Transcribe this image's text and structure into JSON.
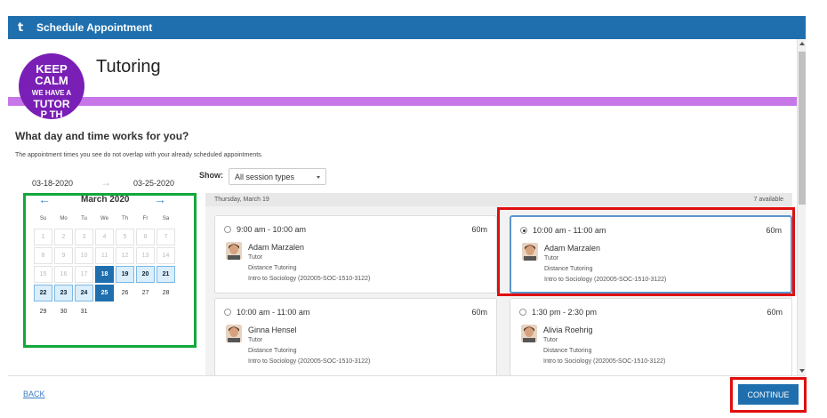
{
  "window": {
    "logo": "t",
    "title": "Schedule Appointment"
  },
  "header": {
    "title": "Tutoring",
    "badge_lines": [
      "KEEP",
      "CALM",
      "WE HAVE A",
      "TUTOR",
      "P TH"
    ]
  },
  "intro": {
    "question": "What day and time works for you?",
    "hint": "The appointment times you see do not overlap with your already scheduled appointments."
  },
  "range": {
    "start": "03-18-2020",
    "end": "03-25-2020",
    "arrow": "→"
  },
  "filter": {
    "label": "Show:",
    "value": "All session types"
  },
  "calendar": {
    "month": "March 2020",
    "prev": "←",
    "next": "→",
    "dow": [
      "Su",
      "Mo",
      "Tu",
      "We",
      "Th",
      "Fr",
      "Sa"
    ],
    "weeks": [
      [
        {
          "d": "1",
          "s": "past"
        },
        {
          "d": "2",
          "s": "past"
        },
        {
          "d": "3",
          "s": "past"
        },
        {
          "d": "4",
          "s": "past"
        },
        {
          "d": "5",
          "s": "past"
        },
        {
          "d": "6",
          "s": "past"
        },
        {
          "d": "7",
          "s": "past"
        }
      ],
      [
        {
          "d": "8",
          "s": "past"
        },
        {
          "d": "9",
          "s": "past"
        },
        {
          "d": "10",
          "s": "past"
        },
        {
          "d": "11",
          "s": "past"
        },
        {
          "d": "12",
          "s": "past"
        },
        {
          "d": "13",
          "s": "past"
        },
        {
          "d": "14",
          "s": "past"
        }
      ],
      [
        {
          "d": "15",
          "s": "past"
        },
        {
          "d": "16",
          "s": "past"
        },
        {
          "d": "17",
          "s": "past"
        },
        {
          "d": "18",
          "s": "sel"
        },
        {
          "d": "19",
          "s": "avail"
        },
        {
          "d": "20",
          "s": "avail"
        },
        {
          "d": "21",
          "s": "avail"
        }
      ],
      [
        {
          "d": "22",
          "s": "avail"
        },
        {
          "d": "23",
          "s": "avail"
        },
        {
          "d": "24",
          "s": "avail"
        },
        {
          "d": "25",
          "s": "sel"
        },
        {
          "d": "26",
          "s": "norm"
        },
        {
          "d": "27",
          "s": "norm"
        },
        {
          "d": "28",
          "s": "norm"
        }
      ],
      [
        {
          "d": "29",
          "s": "norm"
        },
        {
          "d": "30",
          "s": "norm"
        },
        {
          "d": "31",
          "s": "norm"
        },
        {
          "d": "",
          "s": "empty"
        },
        {
          "d": "",
          "s": "empty"
        },
        {
          "d": "",
          "s": "empty"
        },
        {
          "d": "",
          "s": "empty"
        }
      ]
    ]
  },
  "slots": {
    "date": "Thursday, March 19",
    "count": "7 available",
    "items": [
      {
        "time": "9:00 am - 10:00 am",
        "duration": "60m",
        "tutor": "Adam Marzalen",
        "role": "Tutor",
        "type": "Distance Tutoring",
        "course": "Intro to Sociology (202005-SOC-1510-3122)",
        "selected": false
      },
      {
        "time": "10:00 am - 11:00 am",
        "duration": "60m",
        "tutor": "Adam Marzalen",
        "role": "Tutor",
        "type": "Distance Tutoring",
        "course": "Intro to Sociology (202005-SOC-1510-3122)",
        "selected": true
      },
      {
        "time": "10:00 am - 11:00 am",
        "duration": "60m",
        "tutor": "Ginna Hensel",
        "role": "Tutor",
        "type": "Distance Tutoring",
        "course": "Intro to Sociology (202005-SOC-1510-3122)",
        "selected": false
      },
      {
        "time": "1:30 pm - 2:30 pm",
        "duration": "60m",
        "tutor": "Alivia Roehrig",
        "role": "Tutor",
        "type": "Distance Tutoring",
        "course": "Intro to Sociology (202005-SOC-1510-3122)",
        "selected": false
      }
    ]
  },
  "footer": {
    "back": "BACK",
    "continue": "CONTINUE"
  },
  "colors": {
    "brand": "#1f6fae",
    "accent_band": "#c877e8",
    "badge_purple": "#7a1fb5",
    "highlight_green": "#13a83b",
    "highlight_red": "#e00e0e"
  }
}
